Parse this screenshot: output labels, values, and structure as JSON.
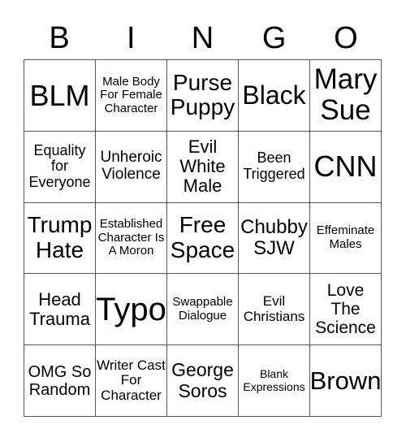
{
  "header": {
    "letters": [
      "B",
      "I",
      "N",
      "G",
      "O"
    ]
  },
  "card": {
    "rows": [
      [
        {
          "text": "BLM",
          "size": "xl"
        },
        {
          "text": "Male Body For Female Character",
          "size": "xs"
        },
        {
          "text": "Purse Puppy",
          "size": "l"
        },
        {
          "text": "Black",
          "size": "l2"
        },
        {
          "text": "Mary Sue",
          "size": "xl2"
        }
      ],
      [
        {
          "text": "Equality for Everyone",
          "size": "s"
        },
        {
          "text": "Unheroic Violence",
          "size": "s2"
        },
        {
          "text": "Evil White Male",
          "size": "m"
        },
        {
          "text": "Been Triggered",
          "size": "s"
        },
        {
          "text": "CNN",
          "size": "xl"
        }
      ],
      [
        {
          "text": "Trump Hate",
          "size": "l"
        },
        {
          "text": "Established Character Is A Moron",
          "size": "xs"
        },
        {
          "text": "Free Space",
          "size": "l"
        },
        {
          "text": "Chubby SJW",
          "size": "m2"
        },
        {
          "text": "Effeminate Males",
          "size": "xs"
        }
      ],
      [
        {
          "text": "Head Trauma",
          "size": "m"
        },
        {
          "text": "Typo",
          "size": "xxl"
        },
        {
          "text": "Swappable Dialogue",
          "size": "xs"
        },
        {
          "text": "Evil Christians",
          "size": "s3"
        },
        {
          "text": "Love The Science",
          "size": "m3"
        }
      ],
      [
        {
          "text": "OMG So Random",
          "size": "m4"
        },
        {
          "text": "Writer Cast For Character",
          "size": "s3"
        },
        {
          "text": "George Soros",
          "size": "m5"
        },
        {
          "text": "Blank Expressions",
          "size": "xxs"
        },
        {
          "text": "Brown",
          "size": "l3"
        }
      ]
    ]
  },
  "colors": {
    "border": "#555555",
    "text": "#000000",
    "background": "#ffffff"
  }
}
